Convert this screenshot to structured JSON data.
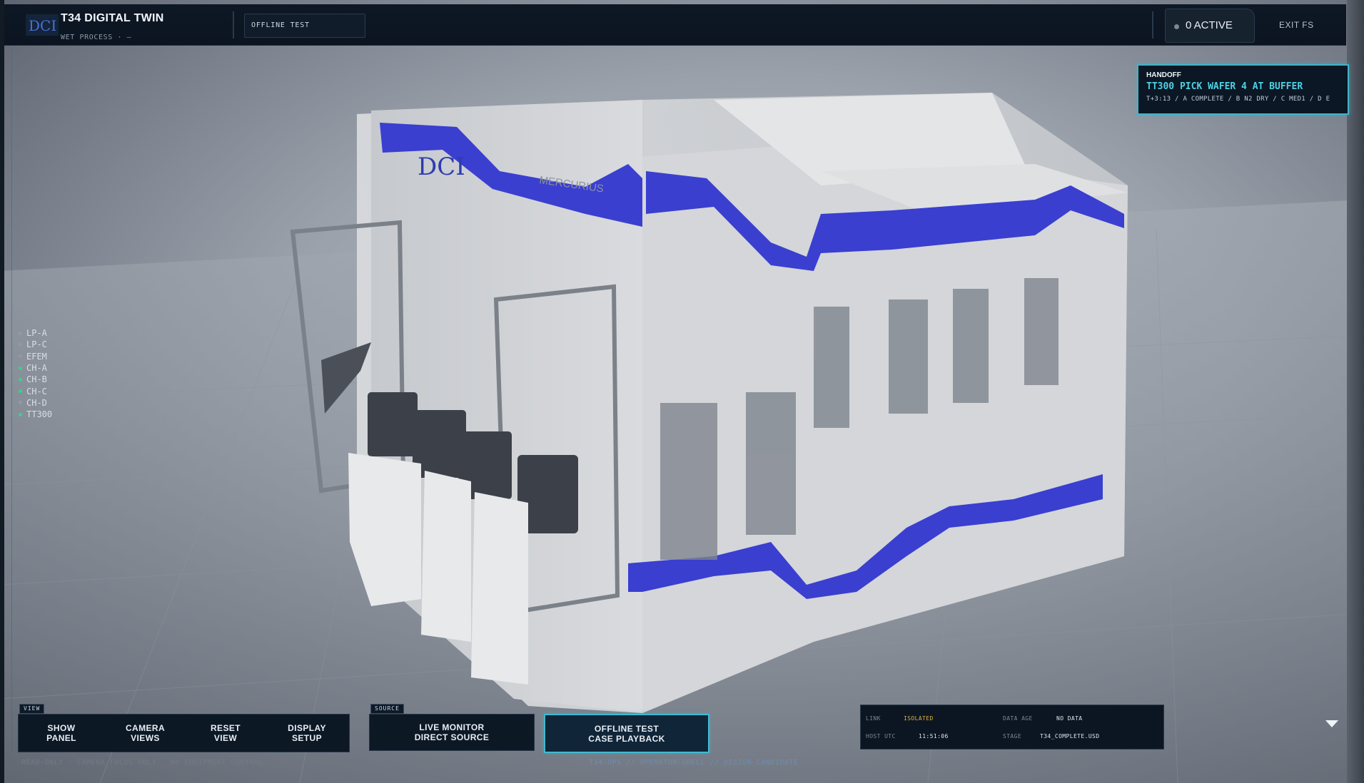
{
  "header": {
    "title": "T34 DIGITAL TWIN",
    "subtitle": "WET PROCESS · —",
    "mode_label": "OFFLINE TEST",
    "active_count": "0 ACTIVE",
    "exit_label": "EXIT FS"
  },
  "handoff": {
    "label": "HANDOFF",
    "headline": "TT300 PICK WAFER 4 AT BUFFER",
    "detail": "T+3:13 / A COMPLETE / B N2 DRY / C MED1 / D E"
  },
  "legend": {
    "items": [
      {
        "label": "LP-A",
        "color": "#8f9aa6"
      },
      {
        "label": "LP-C",
        "color": "#8f9aa6"
      },
      {
        "label": "EFEM",
        "color": "#8f9aa6"
      },
      {
        "label": "CH-A",
        "color": "#35d38a"
      },
      {
        "label": "CH-B",
        "color": "#35d38a"
      },
      {
        "label": "CH-C",
        "color": "#35d38a"
      },
      {
        "label": "CH-D",
        "color": "#8f9aa6"
      },
      {
        "label": "TT300",
        "color": "#35d38a"
      }
    ]
  },
  "view_controls": {
    "tag": "VIEW",
    "buttons": [
      {
        "line1": "SHOW",
        "line2": "PANEL"
      },
      {
        "line1": "CAMERA",
        "line2": "VIEWS"
      },
      {
        "line1": "RESET",
        "line2": "VIEW"
      },
      {
        "line1": "DISPLAY",
        "line2": "SETUP"
      }
    ]
  },
  "source_controls": {
    "tag": "SOURCE",
    "buttons": [
      {
        "line1": "LIVE MONITOR",
        "line2": "DIRECT SOURCE"
      },
      {
        "line1": "OFFLINE TEST",
        "line2": "CASE PLAYBACK"
      }
    ]
  },
  "footer": {
    "left": "READ-ONLY · CAMERA FOCUS ONLY · NO EQUIPMENT CONTROL",
    "center": "T34-OPS // OPERATOR-SHELL // DESIGN CANDIDATE"
  },
  "status": {
    "link_label": "LINK",
    "link_value": "ISOLATED",
    "data_age_label": "DATA AGE",
    "data_age_value": "NO DATA",
    "host_label": "HOST UTC",
    "host_value": "11:51:06",
    "stage_label": "STAGE",
    "stage_value": "T34_COMPLETE.USD"
  },
  "model": {
    "logo_text": "DCI",
    "brand_text": "MERCURIUS"
  },
  "colors": {
    "accent": "#42b9cf",
    "brand_blue": "#3a3fd0",
    "isolated": "#e0b43a"
  }
}
